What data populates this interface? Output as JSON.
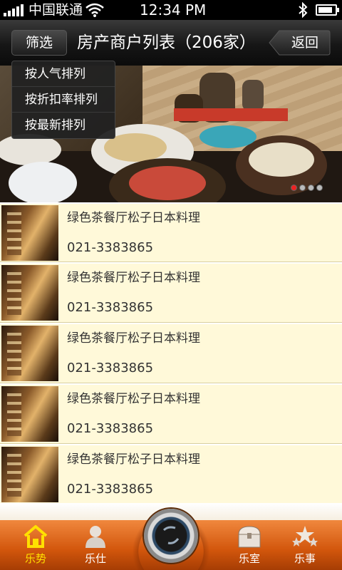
{
  "status": {
    "carrier": "中国联通",
    "time": "12:34 PM",
    "battery_level": 0.85
  },
  "header": {
    "filter_label": "筛选",
    "title": "房产商户列表（206家）",
    "back_label": "返回"
  },
  "menu": {
    "items": [
      "按人气排列",
      "按折扣率排列",
      "按最新排列"
    ]
  },
  "banner": {
    "slides": 4,
    "active_index": 0
  },
  "list": [
    {
      "name": "绿色茶餐厅松子日本料理",
      "phone": "021-3383865"
    },
    {
      "name": "绿色茶餐厅松子日本料理",
      "phone": "021-3383865"
    },
    {
      "name": "绿色茶餐厅松子日本料理",
      "phone": "021-3383865"
    },
    {
      "name": "绿色茶餐厅松子日本料理",
      "phone": "021-3383865"
    },
    {
      "name": "绿色茶餐厅松子日本料理",
      "phone": "021-3383865"
    }
  ],
  "tabs": [
    {
      "label": "乐势",
      "icon": "home-icon",
      "active": true
    },
    {
      "label": "乐仕",
      "icon": "person-icon",
      "active": false
    },
    {
      "label": "乐室",
      "icon": "treasure-chest-icon",
      "active": false
    },
    {
      "label": "乐事",
      "icon": "stars-icon",
      "active": false
    }
  ],
  "colors": {
    "accent_orange": "#e06a1c",
    "list_bg": "#fff9d9",
    "active_tab": "#ffe000"
  }
}
